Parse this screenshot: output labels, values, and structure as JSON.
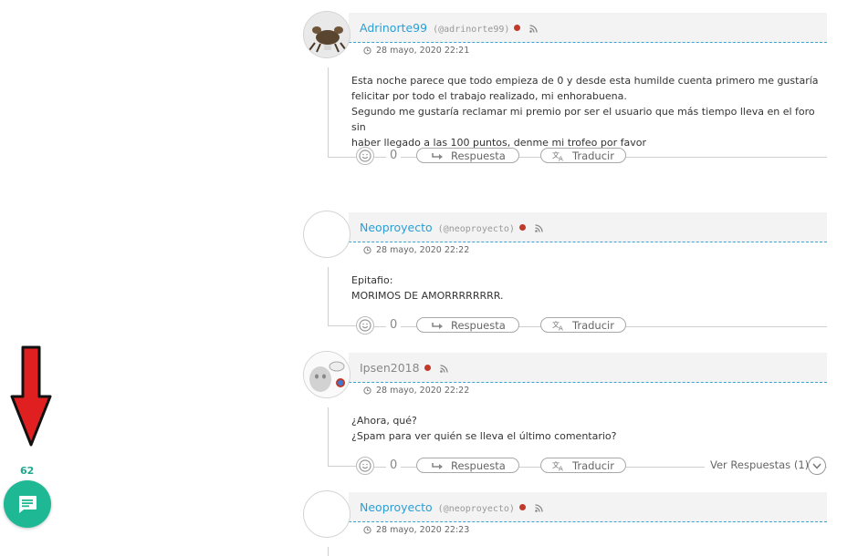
{
  "comments": [
    {
      "author": "Adrinorte99",
      "handle": "(@adrinorte99)",
      "date": "28 mayo, 2020 22:21",
      "lines": [
        "Esta noche parece que todo empieza de 0 y desde esta humilde cuenta primero me gustaría",
        "felicitar por todo el trabajo realizado, mi enhorabuena.",
        "Segundo me gustaría reclamar mi premio por ser el usuario que más tiempo lleva en el foro sin",
        "haber llegado a las 100 puntos, denme mi trofeo por favor"
      ],
      "reactions": "0",
      "reply_label": "Respuesta",
      "translate_label": "Traducir"
    },
    {
      "author": "Neoproyecto",
      "handle": "(@neoproyecto)",
      "date": "28 mayo, 2020 22:22",
      "lines": [
        "Epitafio:",
        "MORIMOS DE AMORRRRRRRR."
      ],
      "reactions": "0",
      "reply_label": "Respuesta",
      "translate_label": "Traducir"
    },
    {
      "author": "Ipsen2018",
      "handle": "",
      "date": "28 mayo, 2020 22:22",
      "lines": [
        "¿Ahora, qué?",
        "¿Spam para ver quién se lleva el último comentario?"
      ],
      "reactions": "0",
      "reply_label": "Respuesta",
      "translate_label": "Traducir",
      "view_replies": "Ver Respuestas (1)"
    },
    {
      "author": "Neoproyecto",
      "handle": "(@neoproyecto)",
      "date": "28 mayo, 2020 22:23"
    }
  ],
  "fab": {
    "count": "62",
    "icon": "chat-icon",
    "color": "#1fb895"
  },
  "annotation": {
    "color": "#e02020",
    "icon": "down-arrow"
  },
  "colors": {
    "link": "#2a9fd6",
    "status_dot": "#c0392b"
  }
}
